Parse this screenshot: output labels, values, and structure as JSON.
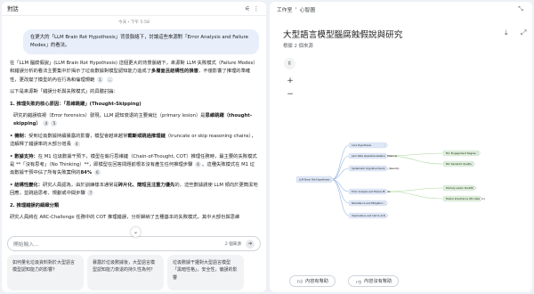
{
  "left": {
    "title": "對話",
    "timestamp": "今天・下午 5:58",
    "user_message": "在更大的「LLM Brain Rot Hypothesis」背景脈絡下，討論這些來源對「Error Analysis and Failure Modes」的看法。",
    "answer": {
      "p1_a": "在「LLM 腦腐假說」(LLM Brain Rot Hypothesis) 這個更大的背景脈絡下，來源對 LLM 失敗模式（Failure Modes）和錯誤分析的看法主要集中於揭示了垃圾數據對模型認知能力造成了",
      "p1_b": "多層面且結構性的損害",
      "p1_c": "，不僅影響了推理的準確性，更改變了模型的內在行為和倫理規範",
      "p1_cite": "1",
      "p2": "以下是來源對「錯誤分析與失敗模式」的具體討論：",
      "h1": "1. 推理失敗的核心原因：「思維跳躍」(Thought-Skipping)",
      "p3_a": "研究的錯誤檢視（Error forensics）發現，LLM 認知衰退的主要病灶（primary lesion）是",
      "p3_b": "思維跳躍（thought-skipping）",
      "p3_cite1": "4",
      "p3_cite2": "5",
      "b1_a": "• 機制：",
      "b1_b": "受到垃圾數據持續暴露的影響，模型會越來越常",
      "b1_c": "截斷或跳過推理鏈",
      "b1_d": "（truncate or skip reasoning chains），這解釋了錯誤率的大部分增長",
      "b1_cite": "4",
      "b2_a": "• 數據支持：",
      "b2_b": "在 M1 垃圾數據干預下，模型在執行思維鏈（Chain-of-Thought, COT）推理任務時，最主要的失敗模式是 **「沒有思考」（No Thinking）**，即模型在回答問題前根本沒有產生任何推理步驟",
      "b2_cite1": "6",
      "b2_c": "。這種失敗模式在 M1 垃圾數據干預中佔了所有失敗案例的",
      "b2_d": "84%",
      "b2_cite2": "6",
      "b3_a": "• 結構性變化：",
      "b3_b": "研究人員認為，由於訓練樣本通常是",
      "b3_c": "碎片化、簡短且注重力優先",
      "b3_d": "的，這些數據誘使 LLM 傾向於更簡潔地回應，並跳過思考、規劃或中間步驟",
      "b3_cite": "7",
      "h2": "2. 推理錯誤的細緻分類",
      "p4": "研究人員將在 ARC-Challenge 任務中的 COT 推理錯誤，分析歸納了五種基本的失敗模式，其中大部份與思維"
    },
    "input_placeholder": "開始輸入...",
    "source_count": "2 個來源",
    "suggestions": [
      "如何量化垃圾資料對於大型語言模型認知能力的影響？",
      "暴露於垃圾數據後，大型語言模型認知能力衰退的持久性為何？",
      "垃圾數據干擾對大型語言模型「黑暗性格」，安全性，偏誤的影響"
    ]
  },
  "right": {
    "breadcrumb_root": "工作室",
    "breadcrumb_current": "心智圖",
    "title": "大型語言模型腦腐蝕假說與研究",
    "subtitle": "根據 2 個來源",
    "feedback_good": "內容有幫助",
    "feedback_bad": "內容沒有幫助",
    "mindmap": {
      "root": "LLM Brain Rot Hypothesis",
      "children": [
        "Core Hypothesis",
        "Junk Data Operationalization (Metrics)",
        "Systematic Cognitive Declines (Results)",
        "Error Analysis and Failure Modes",
        "Persistence and Mitigation",
        "Implications and Call to Action"
      ],
      "grandchildren": [
        "M1: Engagement Degree",
        "M2: Semantic Quality",
        "Primary Lesion Identified",
        "Failure Importance (M1 Ablation)"
      ]
    },
    "colors": {
      "accent": "#1a73e8",
      "node_blue": "#dde7f7",
      "node_green": "#ddf0d8",
      "edge_blue": "#9bb8e3",
      "edge_green": "#a9d69a"
    }
  }
}
